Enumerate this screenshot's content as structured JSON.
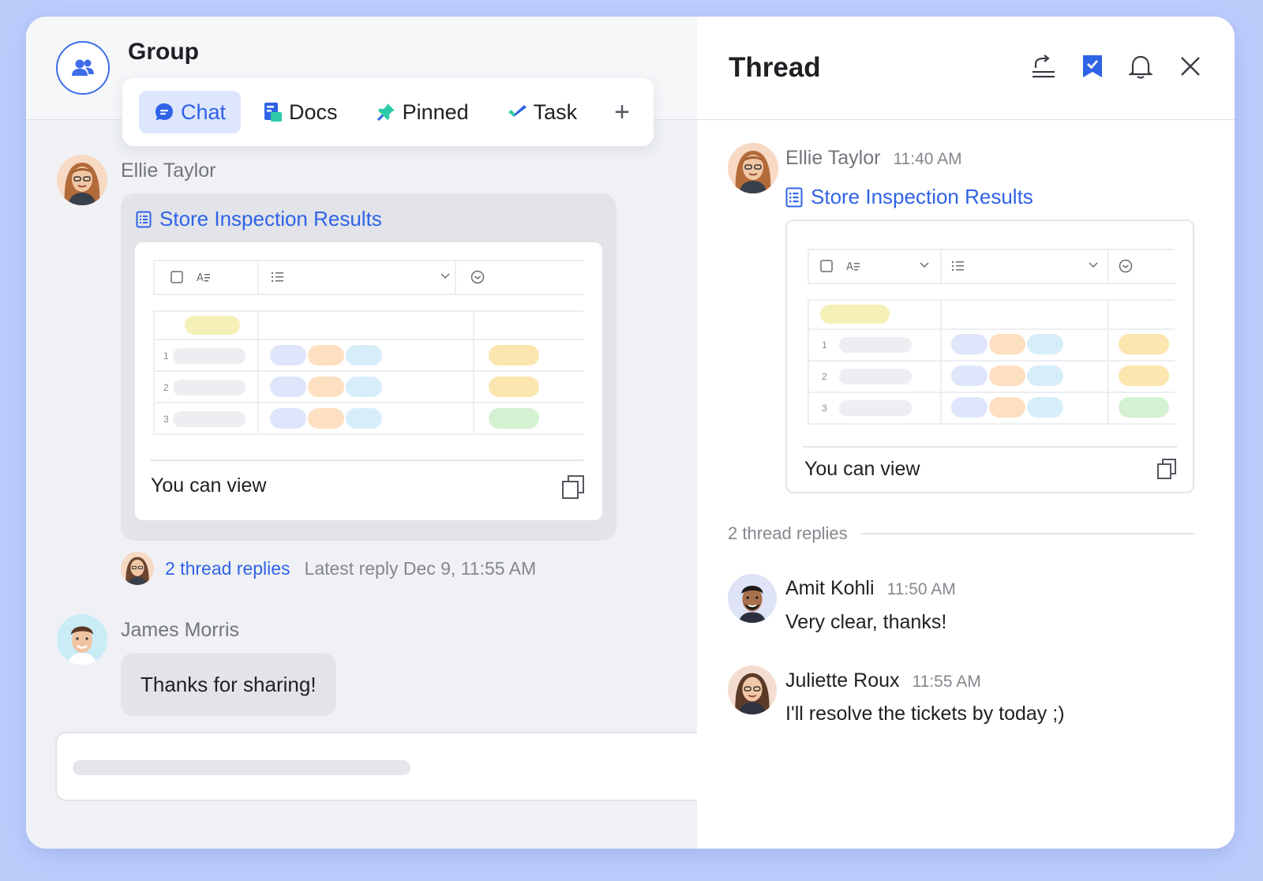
{
  "group": {
    "title": "Group",
    "avatar_icon": "group-icon"
  },
  "tabs": [
    {
      "label": "Chat",
      "icon": "chat-icon",
      "active": true
    },
    {
      "label": "Docs",
      "icon": "docs-icon",
      "active": false
    },
    {
      "label": "Pinned",
      "icon": "pin-icon",
      "active": false
    },
    {
      "label": "Task",
      "icon": "check-icon",
      "active": false
    }
  ],
  "add_tab_label": "+",
  "chat": {
    "message1": {
      "author": "Ellie Taylor",
      "doc_title": "Store Inspection Results",
      "permission": "You can view",
      "row_numbers": [
        "1",
        "2",
        "3"
      ]
    },
    "replies": {
      "count_label": "2 thread replies",
      "latest": "Latest reply Dec 9, 11:55 AM"
    },
    "message2": {
      "author": "James Morris",
      "text": "Thanks for sharing!"
    }
  },
  "thread": {
    "title": "Thread",
    "header_icons": [
      "share-icon",
      "bookmark-icon",
      "bell-icon",
      "close-icon"
    ],
    "root": {
      "author": "Ellie Taylor",
      "time": "11:40 AM",
      "doc_title": "Store Inspection Results",
      "permission": "You can view",
      "row_numbers": [
        "1",
        "2",
        "3"
      ]
    },
    "divider_label": "2 thread replies",
    "replies": [
      {
        "author": "Amit Kohli",
        "time": "11:50 AM",
        "text": "Very clear, thanks!"
      },
      {
        "author": "Juliette Roux",
        "time": "11:55 AM",
        "text": "I'll resolve the tickets by today ;)"
      }
    ]
  },
  "colors": {
    "accent": "#2f63e6",
    "background": "#bccdfc",
    "pill_yellow": "#f5f0b8",
    "pill_blue": "#dfe6fb",
    "pill_orange": "#fde0c2",
    "pill_cyan": "#d7eefa",
    "pill_amber": "#fbe6b0",
    "pill_green": "#d4f1d2"
  }
}
